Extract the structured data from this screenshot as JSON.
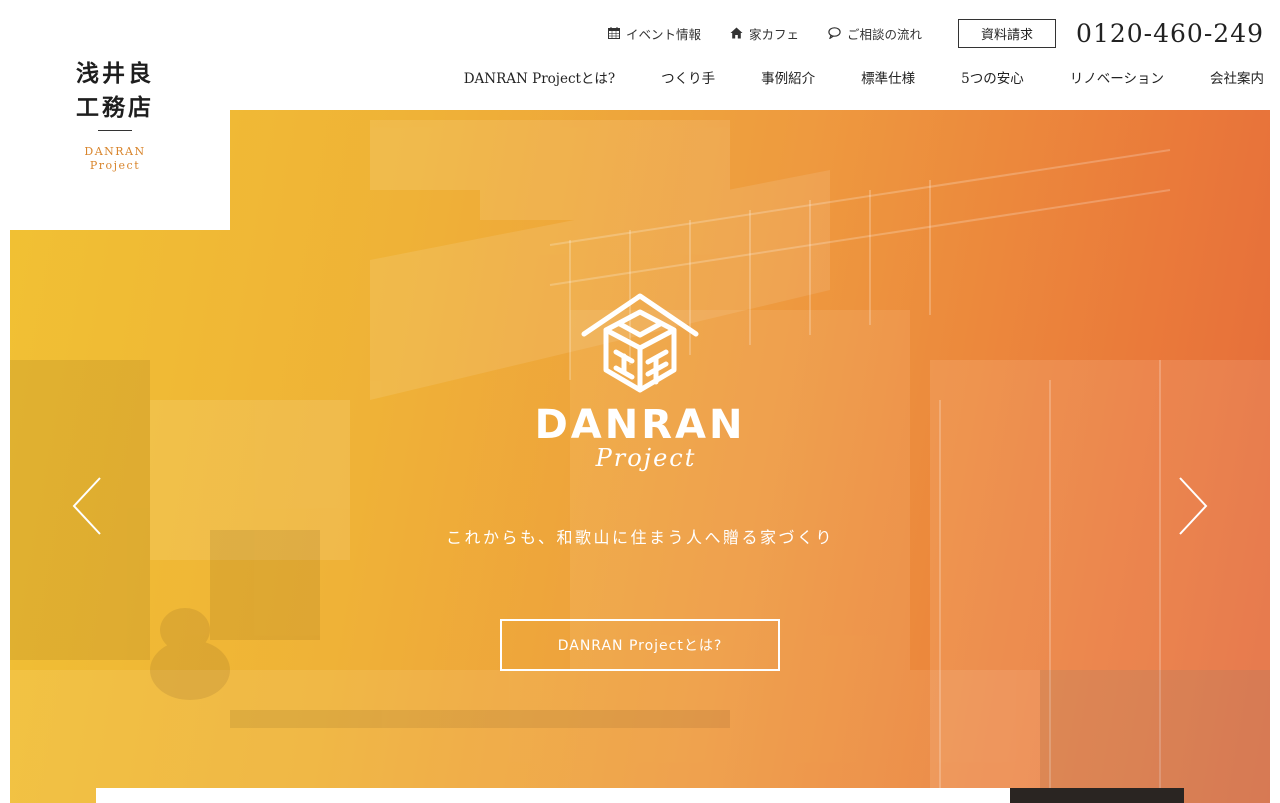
{
  "logo": {
    "line1": "浅井良",
    "line2": "工務店",
    "sub1": "DANRAN",
    "sub2": "Project"
  },
  "utility": {
    "items": [
      {
        "label": "イベント情報",
        "icon": "calendar-icon"
      },
      {
        "label": "家カフェ",
        "icon": "home-icon"
      },
      {
        "label": "ご相談の流れ",
        "icon": "chat-icon"
      }
    ],
    "request_label": "資料請求",
    "phone": "0120-460-249"
  },
  "nav": {
    "items": [
      {
        "label": "DANRAN Projectとは?"
      },
      {
        "label": "つくり手"
      },
      {
        "label": "事例紹介"
      },
      {
        "label": "標準仕様"
      },
      {
        "label": "5つの安心"
      },
      {
        "label": "リノベーション"
      },
      {
        "label": "会社案内"
      }
    ]
  },
  "hero": {
    "brand": "DANRAN",
    "brand_script": "Project",
    "tagline": "これからも、和歌山に住まう人へ贈る家づくり",
    "cta_label": "DANRAN Projectとは?",
    "prev_icon": "chevron-left-icon",
    "next_icon": "chevron-right-icon"
  },
  "colors": {
    "accent": "#d8842b",
    "gradient_start": "#f1c133",
    "gradient_end": "#e46a3a"
  }
}
